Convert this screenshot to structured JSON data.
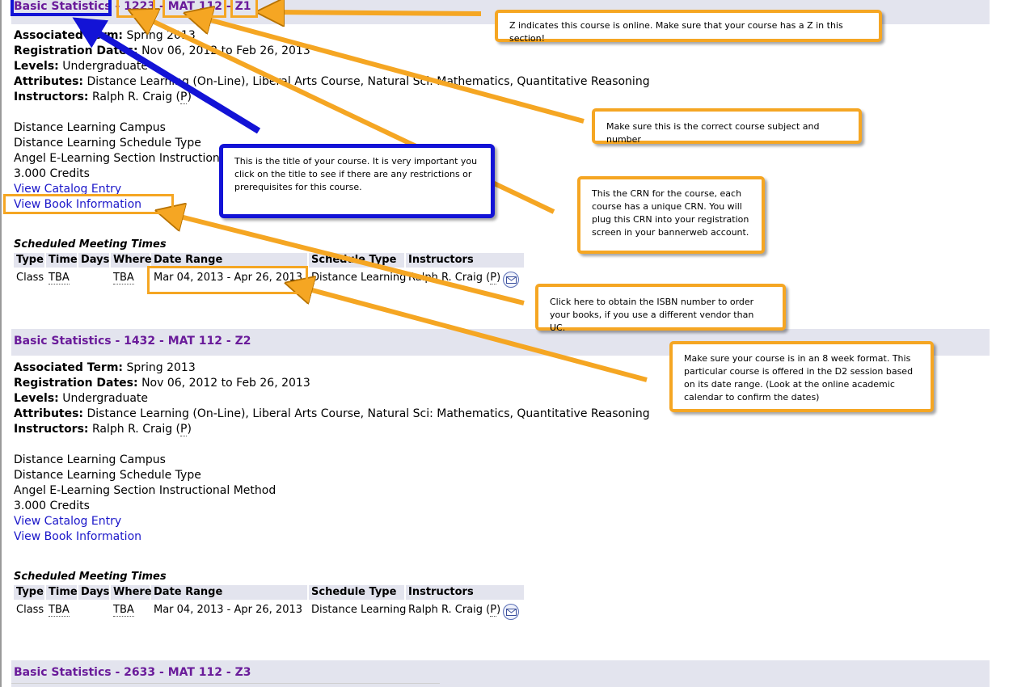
{
  "courses": [
    {
      "title": "Basic Statistics",
      "crn": "1223",
      "subject": "MAT 112",
      "section": "Z1",
      "separator": " - ",
      "term_label": "Associated Term:",
      "term": "Spring 2013",
      "reg_label": "Registration Dates:",
      "reg_dates": "Nov 06, 2012 to Feb 26, 2013",
      "levels_label": "Levels:",
      "levels": "Undergraduate",
      "attributes_label": "Attributes:",
      "attributes": "Distance Learning (On-Line), Liberal Arts Course, Natural Sci: Mathematics, Quantitative Reasoning",
      "instructors_label": "Instructors:",
      "instructor": "Ralph R. Craig",
      "primary_marker": "P",
      "campus": "Distance Learning Campus",
      "schedule_type": "Distance Learning Schedule Type",
      "method": "Angel E-Learning Section Instructional Method",
      "credits": "3.000 Credits",
      "catalog_link": "View Catalog Entry",
      "book_link": "View Book Information",
      "meeting_caption": "Scheduled Meeting Times",
      "meeting_headers": [
        "Type",
        "Time",
        "Days",
        "Where",
        "Date Range",
        "Schedule Type",
        "Instructors"
      ],
      "meeting_row": {
        "type": "Class",
        "time": "TBA",
        "days": "",
        "where": "TBA",
        "date_range": "Mar 04, 2013 - Apr 26, 2013",
        "schedule_type": "Distance Learning",
        "instructor": "Ralph R. Craig",
        "marker": "P"
      }
    },
    {
      "title": "Basic Statistics",
      "crn": "1432",
      "subject": "MAT 112",
      "section": "Z2",
      "separator": " - ",
      "term_label": "Associated Term:",
      "term": "Spring 2013",
      "reg_label": "Registration Dates:",
      "reg_dates": "Nov 06, 2012 to Feb 26, 2013",
      "levels_label": "Levels:",
      "levels": "Undergraduate",
      "attributes_label": "Attributes:",
      "attributes": "Distance Learning (On-Line), Liberal Arts Course, Natural Sci: Mathematics, Quantitative Reasoning",
      "instructors_label": "Instructors:",
      "instructor": "Ralph R. Craig",
      "primary_marker": "P",
      "campus": "Distance Learning Campus",
      "schedule_type": "Distance Learning Schedule Type",
      "method": "Angel E-Learning Section Instructional Method",
      "credits": "3.000 Credits",
      "catalog_link": "View Catalog Entry",
      "book_link": "View Book Information",
      "meeting_caption": "Scheduled Meeting Times",
      "meeting_headers": [
        "Type",
        "Time",
        "Days",
        "Where",
        "Date Range",
        "Schedule Type",
        "Instructors"
      ],
      "meeting_row": {
        "type": "Class",
        "time": "TBA",
        "days": "",
        "where": "TBA",
        "date_range": "Mar 04, 2013 - Apr 26, 2013",
        "schedule_type": "Distance Learning",
        "instructor": "Ralph R. Craig",
        "marker": "P"
      }
    },
    {
      "title": "Basic Statistics",
      "crn": "2633",
      "subject": "MAT 112",
      "section": "Z3",
      "separator": " - "
    }
  ],
  "annotations": {
    "online": "Z indicates this course is online. Make sure that your course has a Z in this section!",
    "subject": "Make sure this is the correct course subject and number",
    "title": "This is the title of your course. It is very important you click on the title to see if there are any restrictions or prerequisites for this course.",
    "crn": "This the CRN for the course, each course has a unique CRN. You will plug this CRN into your registration screen in your bannerweb account.",
    "isbn": "Click here to obtain the ISBN number to order your books, if you use a different vendor than UC.",
    "format": "Make sure your course is in an 8 week format. This particular course is offered in the D2 session based on its date range. (Look at the online academic calendar to confirm the dates)"
  },
  "colors": {
    "annotation_orange": "#f5a623",
    "annotation_blue": "#1313d6",
    "course_title": "#6a1b9a",
    "link": "#1a16c9",
    "header_band": "#e3e4ee"
  },
  "icons": [
    "mail-icon",
    "arrow-icon"
  ]
}
